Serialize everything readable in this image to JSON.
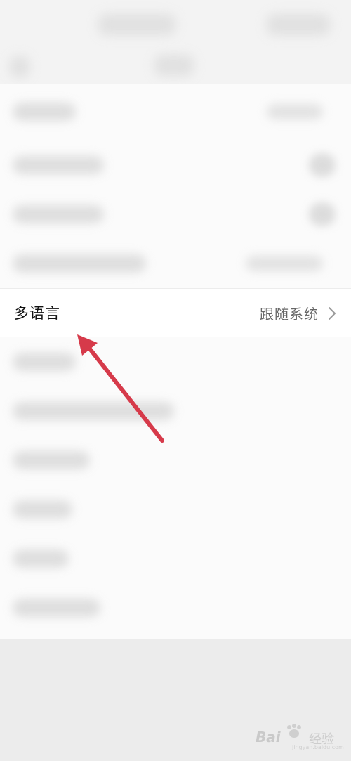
{
  "settings": {
    "language_row": {
      "label": "多语言",
      "value": "跟随系统"
    }
  },
  "colors": {
    "arrow": "#d63a4a",
    "label_text": "#111111",
    "value_text": "#666666"
  },
  "icons": {
    "row_chevron": "chevron-right-icon",
    "annotation": "arrow-icon"
  },
  "watermark": {
    "brand": "Bai",
    "suffix": "经验",
    "url": "jingyan.baidu.com"
  }
}
